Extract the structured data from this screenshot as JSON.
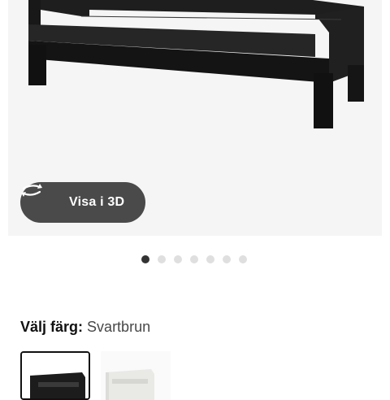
{
  "product_view": {
    "view_3d_label": "Visa i 3D",
    "slide_count": 7,
    "active_slide": 1
  },
  "color_selector": {
    "label": "Välj färg:",
    "selected_color": "Svartbrun",
    "options": [
      "Svartbrun",
      "Vit"
    ]
  },
  "colors": {
    "furniture_dark": "#1c1c1c",
    "button_bg": "#4a4a4a",
    "image_bg": "#f5f5f5"
  }
}
